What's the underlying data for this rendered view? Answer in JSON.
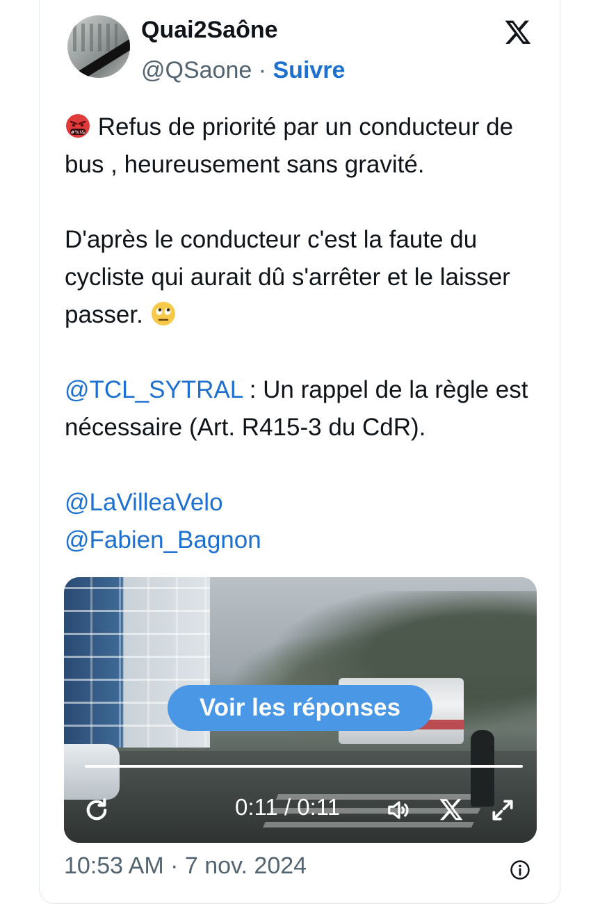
{
  "author": {
    "display_name": "Quai2Saône",
    "handle": "@QSaone",
    "separator": " · ",
    "follow_label": "Suivre"
  },
  "tweet": {
    "line1": " Refus de priorité par un conducteur de bus , heureusement sans gravité.",
    "para2": "D'après le conducteur c'est la faute du cycliste qui aurait dû s'arrêter et le laisser passer. ",
    "mention_tcl": "@TCL_SYTRAL",
    "para3_rest": " : Un rappel de la règle est nécessaire (Art. R415-3 du CdR).",
    "mention_villevelo": "@LaVilleaVelo",
    "mention_bagnon": "@Fabien_Bagnon"
  },
  "media": {
    "overlay_button": "Voir les réponses",
    "time_display": "0:11 / 0:11",
    "progress": 1.0
  },
  "footer": {
    "timestamp": "10:53 AM · 7 nov. 2024"
  },
  "icons": {
    "angry": "face-with-symbols-on-mouth",
    "eye_roll": "face-with-rolling-eyes",
    "logo": "x-logo",
    "replay": "replay-icon",
    "volume": "volume-icon",
    "fullscreen": "fullscreen-icon",
    "info": "info-icon"
  },
  "colors": {
    "link": "#1d6fd0",
    "muted": "#536471",
    "overlay_button": "#4a97e6"
  }
}
